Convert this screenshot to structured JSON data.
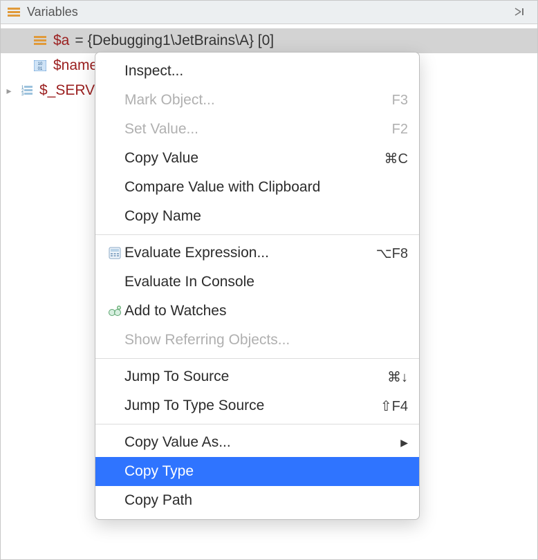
{
  "header": {
    "title": "Variables"
  },
  "variables": [
    {
      "name": "$a",
      "value": "= {Debugging1\\JetBrains\\A} [0]",
      "icon": "object",
      "selected": true,
      "expandable": false
    },
    {
      "name": "$name",
      "value": "",
      "icon": "binary",
      "selected": false,
      "expandable": false
    },
    {
      "name": "$_SERV",
      "value": "",
      "icon": "list",
      "selected": false,
      "expandable": true
    }
  ],
  "menu": [
    {
      "label": "Inspect...",
      "shortcut": "",
      "disabled": false,
      "icon": ""
    },
    {
      "label": "Mark Object...",
      "shortcut": "F3",
      "disabled": true,
      "icon": ""
    },
    {
      "label": "Set Value...",
      "shortcut": "F2",
      "disabled": true,
      "icon": ""
    },
    {
      "label": "Copy Value",
      "shortcut": "⌘C",
      "disabled": false,
      "icon": ""
    },
    {
      "label": "Compare Value with Clipboard",
      "shortcut": "",
      "disabled": false,
      "icon": ""
    },
    {
      "label": "Copy Name",
      "shortcut": "",
      "disabled": false,
      "icon": ""
    },
    {
      "sep": true
    },
    {
      "label": "Evaluate Expression...",
      "shortcut": "⌥F8",
      "disabled": false,
      "icon": "calc"
    },
    {
      "label": "Evaluate In Console",
      "shortcut": "",
      "disabled": false,
      "icon": ""
    },
    {
      "label": "Add to Watches",
      "shortcut": "",
      "disabled": false,
      "icon": "watch"
    },
    {
      "label": "Show Referring Objects...",
      "shortcut": "",
      "disabled": true,
      "icon": ""
    },
    {
      "sep": true
    },
    {
      "label": "Jump To Source",
      "shortcut": "⌘↓",
      "disabled": false,
      "icon": ""
    },
    {
      "label": "Jump To Type Source",
      "shortcut": "⇧F4",
      "disabled": false,
      "icon": ""
    },
    {
      "sep": true
    },
    {
      "label": "Copy Value As...",
      "shortcut": "",
      "disabled": false,
      "icon": "",
      "submenu": true
    },
    {
      "label": "Copy Type",
      "shortcut": "",
      "disabled": false,
      "icon": "",
      "highlight": true
    },
    {
      "label": "Copy Path",
      "shortcut": "",
      "disabled": false,
      "icon": ""
    }
  ],
  "icons": {
    "object_glyph": "≡",
    "binary_glyph": "10\n01",
    "list_glyph": "1\n2\n3"
  }
}
